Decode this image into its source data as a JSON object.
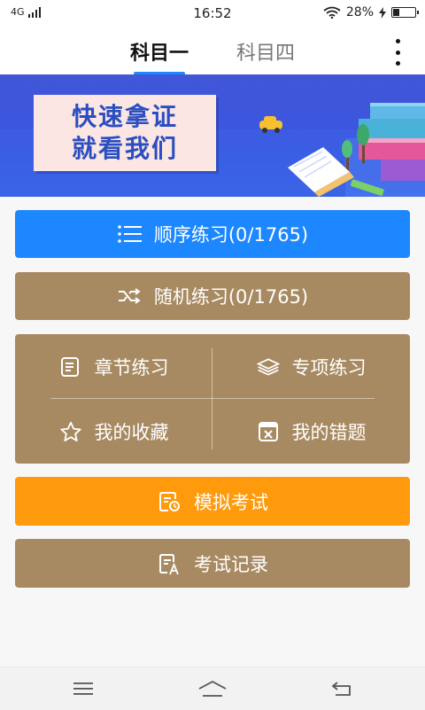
{
  "status_bar": {
    "network": "4G",
    "time": "16:52",
    "battery": "28%"
  },
  "header": {
    "tabs": [
      {
        "label": "科目一"
      },
      {
        "label": "科目四"
      }
    ],
    "more_icon": "more-vertical-icon"
  },
  "banner": {
    "line1": "快速拿证",
    "line2": "就看我们"
  },
  "buttons": {
    "sequential": "顺序练习(0/1765)",
    "random": "随机练习(0/1765)",
    "mock_exam": "模拟考试",
    "exam_records": "考试记录"
  },
  "grid": {
    "chapter": "章节练习",
    "special": "专项练习",
    "favorites": "我的收藏",
    "mistakes": "我的错题"
  },
  "colors": {
    "accent_blue": "#1d87ff",
    "brown": "#a88a62",
    "orange": "#ff9a0c",
    "banner_blue": "#3c55e0"
  },
  "icons": {
    "list": "list-icon",
    "shuffle": "shuffle-icon",
    "chapter": "notebook-icon",
    "special": "layers-icon",
    "favorites": "star-icon",
    "mistakes": "wrong-answers-icon",
    "mock": "exam-clock-icon",
    "records": "exam-record-icon",
    "nav_menu": "menu-icon",
    "nav_home": "home-icon",
    "nav_back": "back-icon"
  }
}
